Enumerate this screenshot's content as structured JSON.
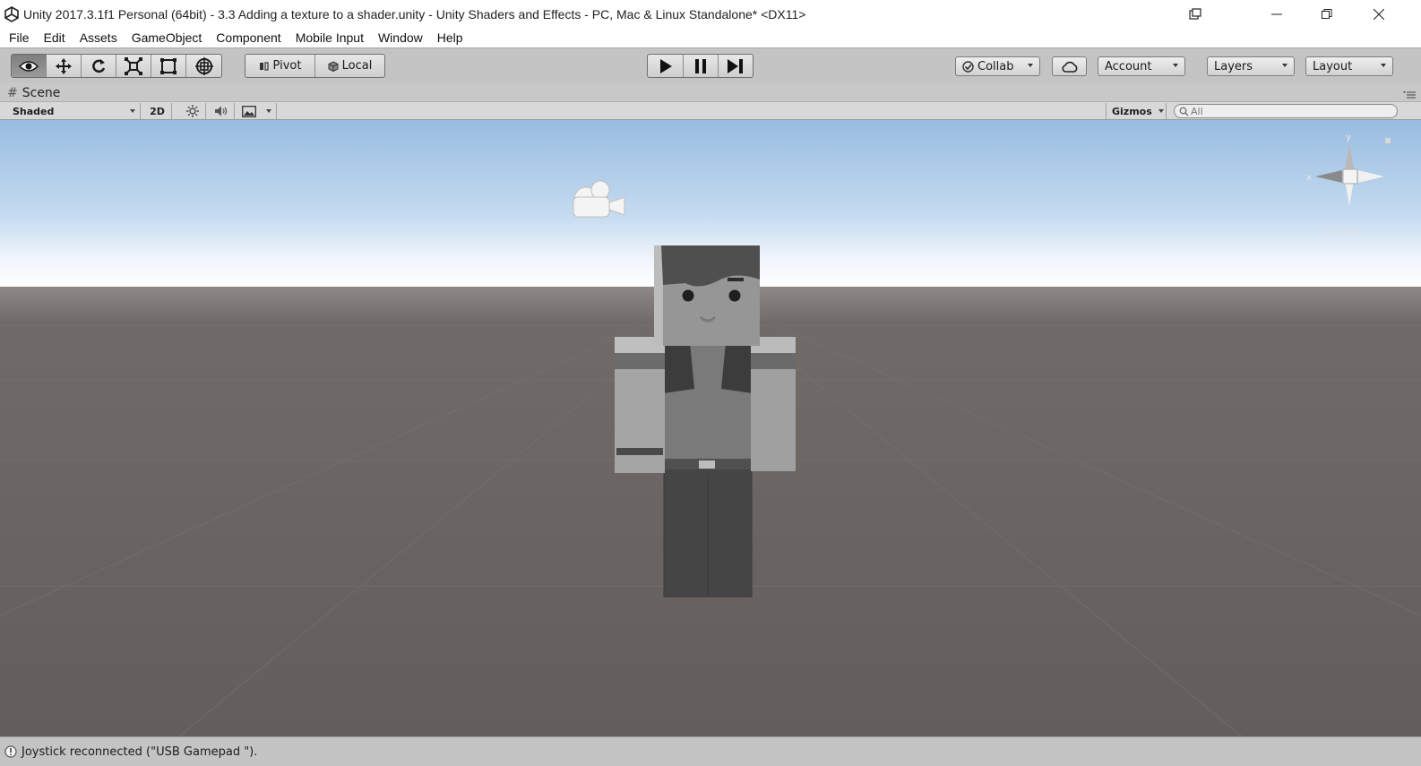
{
  "window": {
    "title": "Unity 2017.3.1f1 Personal (64bit) - 3.3 Adding a texture to a shader.unity - Unity Shaders and Effects - PC, Mac & Linux Standalone* <DX11>",
    "logo_icon": "unity-logo-icon",
    "controls": [
      "restore-down-icon",
      "minimize-icon",
      "maximize-icon",
      "close-icon"
    ]
  },
  "menu": [
    "File",
    "Edit",
    "Assets",
    "GameObject",
    "Component",
    "Mobile Input",
    "Window",
    "Help"
  ],
  "toolbar": {
    "tools": [
      "hand-tool-icon",
      "move-tool-icon",
      "rotate-tool-icon",
      "scale-tool-icon",
      "rect-tool-icon",
      "transform-tool-icon"
    ],
    "active_tool": "hand-tool-icon",
    "pivot_label": "Pivot",
    "local_label": "Local",
    "playback": [
      "play-icon",
      "pause-icon",
      "step-icon"
    ],
    "collab_label": "Collab",
    "cloud_icon": "cloud-icon",
    "account_label": "Account",
    "layers_label": "Layers",
    "layout_label": "Layout"
  },
  "scene": {
    "tab_label": "Scene",
    "shading_mode": "Shaded",
    "mode_2d_label": "2D",
    "gizmos_label": "Gizmos",
    "search_placeholder": "All",
    "gizmo_axes": {
      "x": "x",
      "y": "y"
    },
    "persp_label": "< Persp"
  },
  "status": {
    "message": "Joystick reconnected (\"USB Gamepad \")."
  },
  "colors": {
    "toolbar_bg": "#c4c4c4",
    "sky_top": "#9cc0e4",
    "horizon": "#ffffff",
    "ground": "#6a6462",
    "character_skin": "#8e8e8e",
    "character_dark": "#4a4a4a"
  }
}
